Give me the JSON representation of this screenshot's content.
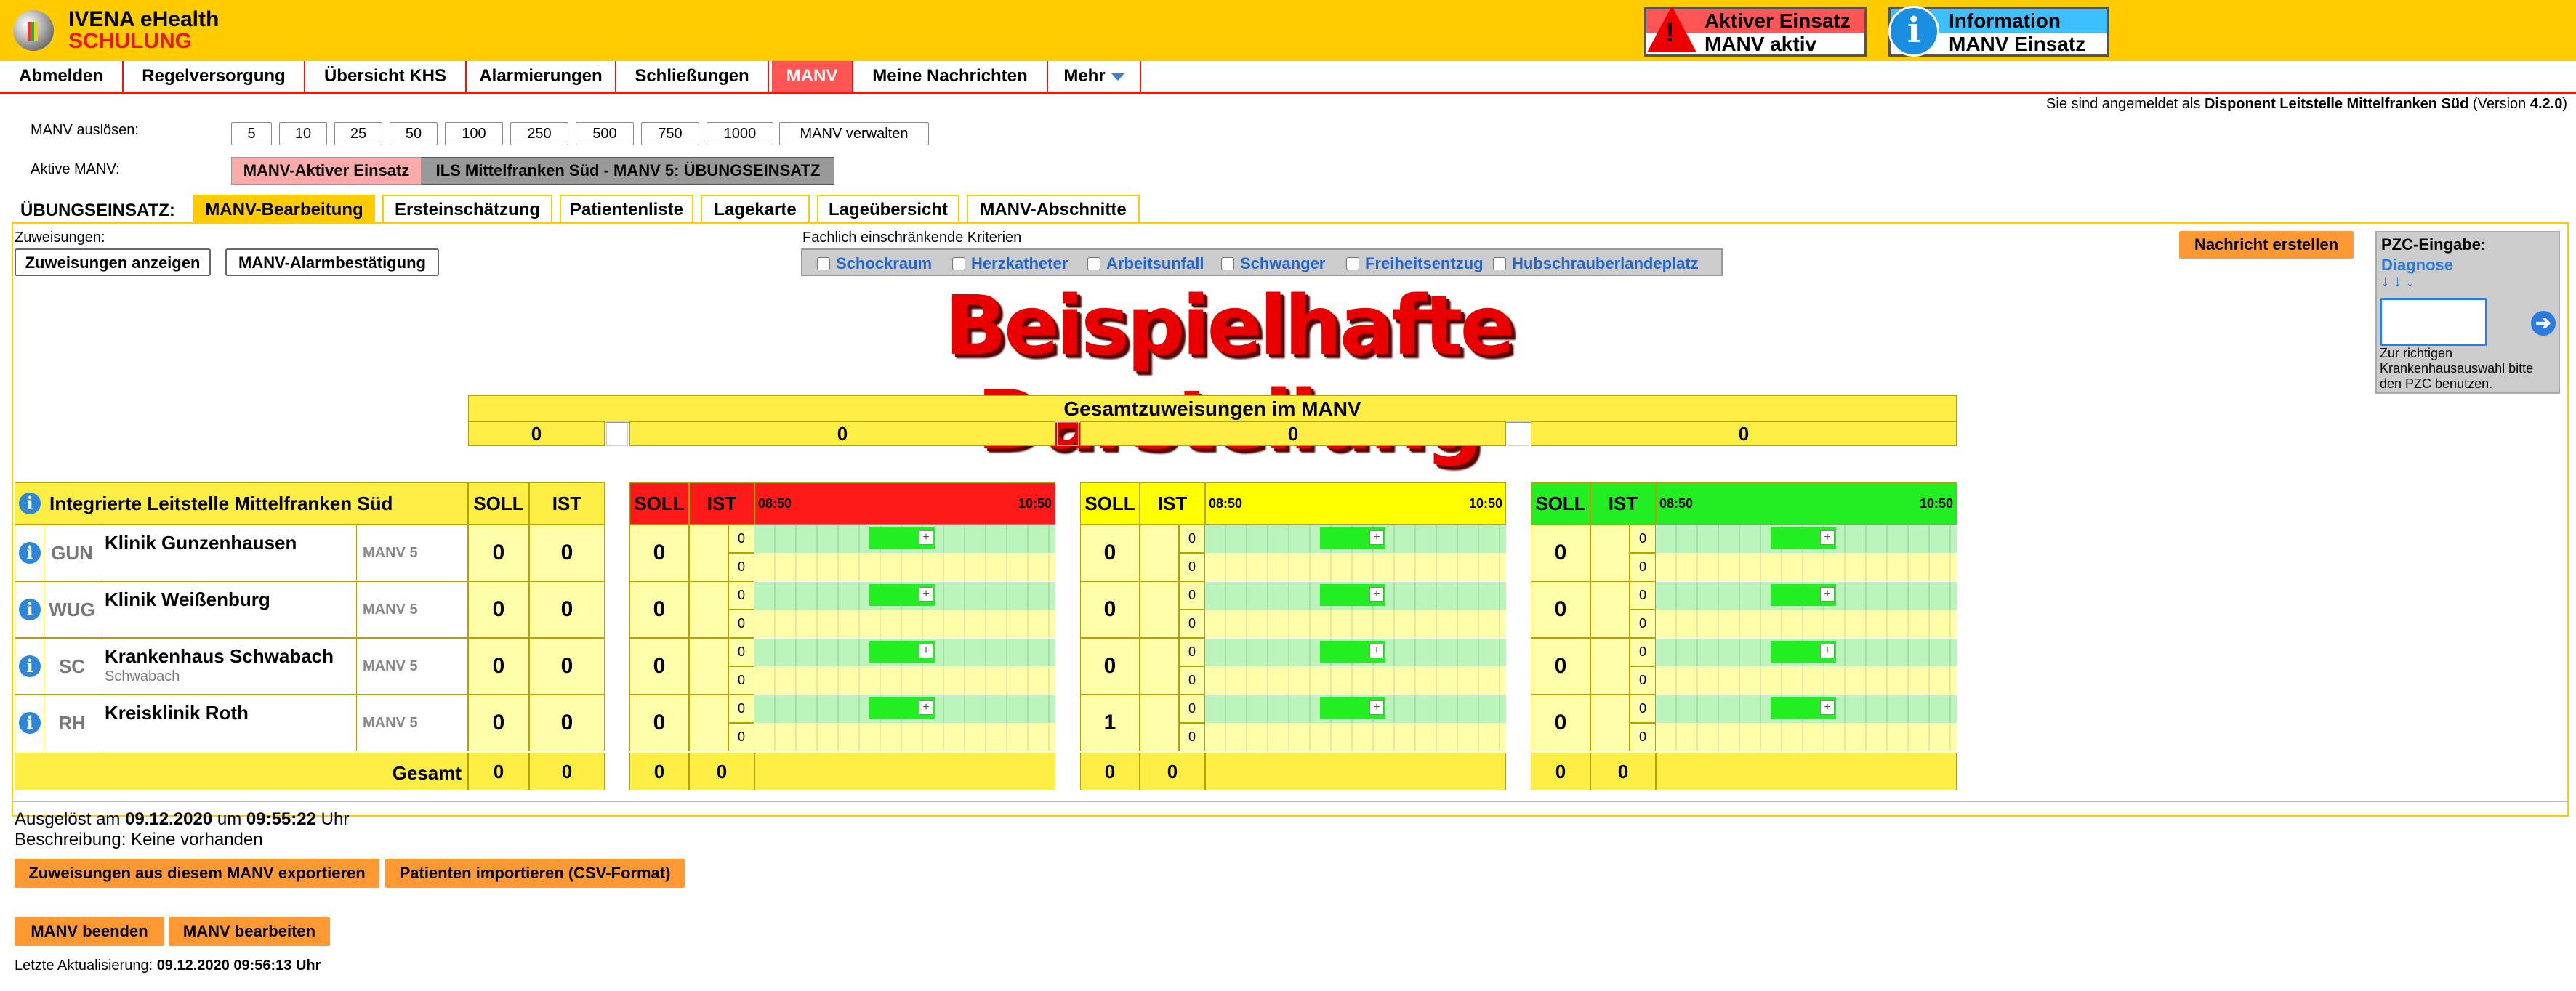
{
  "header": {
    "app_name": "IVENA eHealth",
    "app_sub": "SCHULUNG",
    "warn_title": "Aktiver Einsatz",
    "warn_text": "MANV aktiv",
    "info_title": "Information",
    "info_text": "MANV Einsatz"
  },
  "nav": [
    "Abmelden",
    "Regelversorgung",
    "Übersicht KHS",
    "Alarmierungen",
    "Schließungen",
    "MANV",
    "Meine Nachrichten",
    "Mehr"
  ],
  "login": {
    "prefix": "Sie sind angemeldet als ",
    "user": "Disponent Leitstelle Mittelfranken Süd",
    "version_prefix": " (Version ",
    "version": "4.2.0",
    "version_suffix": ")"
  },
  "trigger": {
    "label": "MANV auslösen:",
    "buttons": [
      "5",
      "10",
      "25",
      "50",
      "100",
      "250",
      "500",
      "750",
      "1000"
    ],
    "manage": "MANV verwalten"
  },
  "active": {
    "label": "Aktive MANV:",
    "badge": "MANV-Aktiver Einsatz",
    "name": "ILS Mittelfranken Süd - MANV 5: ÜBUNGSEINSATZ"
  },
  "tabs": {
    "prefix": "ÜBUNGSEINSATZ:",
    "items": [
      "MANV-Bearbeitung",
      "Ersteinschätzung",
      "Patientenliste",
      "Lagekarte",
      "Lageübersicht",
      "MANV-Abschnitte"
    ]
  },
  "assign": {
    "label": "Zuweisungen:",
    "show": "Zuweisungen anzeigen",
    "confirm": "MANV-Alarmbestätigung"
  },
  "criteria": {
    "label": "Fachlich einschränkende Kriterien",
    "items": [
      "Schockraum",
      "Herzkatheter",
      "Arbeitsunfall",
      "Schwanger",
      "Freiheitsentzug",
      "Hubschrauberlandeplatz"
    ]
  },
  "message_button": "Nachricht erstellen",
  "pzc": {
    "title": "PZC-Eingabe:",
    "link": "Diagnose",
    "arrows": "↓↓↓",
    "hint": "Zur richtigen Krankenhausauswahl bitte den PZC benutzen."
  },
  "watermark": "Beispielhafte Darstellung",
  "totals": {
    "title": "Gesamtzuweisungen im MANV",
    "values": [
      "0",
      "0",
      "0",
      "0"
    ]
  },
  "table": {
    "org": "Integrierte Leitstelle Mittelfranken Süd",
    "soll": "SOLL",
    "ist": "IST",
    "t_start": "08:50",
    "t_end": "10:50",
    "rows": [
      {
        "code": "GUN",
        "name": "Klinik Gunzenhausen",
        "sub": "",
        "manv": "MANV 5",
        "soll": "0",
        "ist": "0",
        "red": "0",
        "yel": "0",
        "grn": "0",
        "r1": "0",
        "r2": "0"
      },
      {
        "code": "WUG",
        "name": "Klinik Weißenburg",
        "sub": "",
        "manv": "MANV 5",
        "soll": "0",
        "ist": "0",
        "red": "0",
        "yel": "0",
        "grn": "0",
        "r1": "0",
        "r2": "0"
      },
      {
        "code": "SC",
        "name": "Krankenhaus Schwabach",
        "sub": "Schwabach",
        "manv": "MANV 5",
        "soll": "0",
        "ist": "0",
        "red": "0",
        "yel": "0",
        "grn": "0",
        "r1": "0",
        "r2": "0"
      },
      {
        "code": "RH",
        "name": "Kreisklinik Roth",
        "sub": "",
        "manv": "MANV 5",
        "soll": "0",
        "ist": "0",
        "red": "0",
        "yel": "1",
        "grn": "0",
        "r1": "0",
        "r2": "0"
      }
    ],
    "total_label": "Gesamt",
    "total": [
      "0",
      "0",
      "0",
      "0",
      "0",
      "0",
      "0",
      "0"
    ]
  },
  "footer": {
    "triggered_prefix": "Ausgelöst am ",
    "date": "09.12.2020",
    "um": " um ",
    "time": "09:55:22",
    "uhr": " Uhr",
    "desc": "Beschreibung: Keine vorhanden",
    "export": "Zuweisungen aus diesem MANV exportieren",
    "import": "Patienten importieren (CSV-Format)",
    "end": "MANV beenden",
    "edit": "MANV bearbeiten",
    "update_label": "Letzte Aktualisierung: ",
    "update": "09.12.2020 09:56:13 Uhr"
  }
}
